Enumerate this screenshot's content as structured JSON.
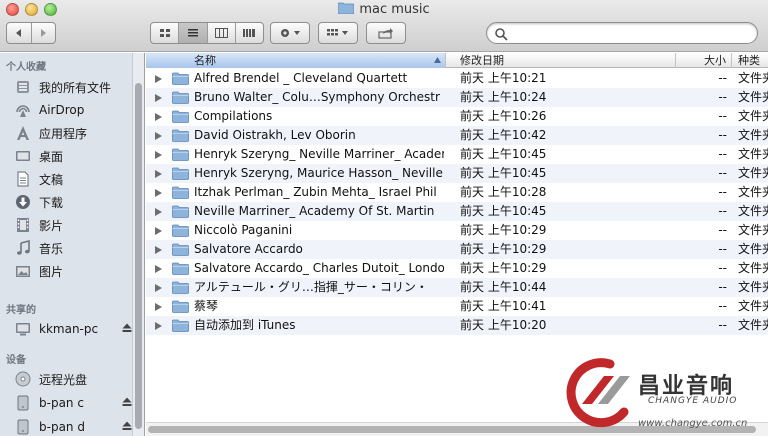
{
  "window": {
    "title": "mac music"
  },
  "search": {
    "value": "",
    "placeholder": ""
  },
  "sidebar": {
    "sections": [
      {
        "title": "个人收藏",
        "items": [
          {
            "label": "我的所有文件",
            "icon": "all-files-icon"
          },
          {
            "label": "AirDrop",
            "icon": "airdrop-icon"
          },
          {
            "label": "应用程序",
            "icon": "applications-icon"
          },
          {
            "label": "桌面",
            "icon": "desktop-icon"
          },
          {
            "label": "文稿",
            "icon": "documents-icon"
          },
          {
            "label": "下载",
            "icon": "downloads-icon"
          },
          {
            "label": "影片",
            "icon": "movies-icon"
          },
          {
            "label": "音乐",
            "icon": "music-icon"
          },
          {
            "label": "图片",
            "icon": "pictures-icon"
          }
        ]
      },
      {
        "title": "共享的",
        "items": [
          {
            "label": "kkman-pc",
            "icon": "network-computer-icon",
            "eject": true
          }
        ]
      },
      {
        "title": "设备",
        "items": [
          {
            "label": "远程光盘",
            "icon": "remote-disc-icon"
          },
          {
            "label": "b-pan c",
            "icon": "drive-icon",
            "eject": true
          },
          {
            "label": "b-pan d",
            "icon": "drive-icon",
            "eject": true
          }
        ]
      }
    ]
  },
  "columns": {
    "name": "名称",
    "date": "修改日期",
    "size": "大小",
    "kind": "种类"
  },
  "files": [
    {
      "name": "Alfred Brendel _ Cleveland Quartett",
      "date": "前天 上午10:21",
      "size": "--",
      "kind": "文件夹"
    },
    {
      "name": "Bruno Walter_ Colu…Symphony Orchestr",
      "date": "前天 上午10:24",
      "size": "--",
      "kind": "文件夹"
    },
    {
      "name": "Compilations",
      "date": "前天 上午10:26",
      "size": "--",
      "kind": "文件夹"
    },
    {
      "name": "David Oistrakh, Lev Oborin",
      "date": "前天 上午10:42",
      "size": "--",
      "kind": "文件夹"
    },
    {
      "name": "Henryk Szeryng_ Neville Marriner_ Academ",
      "date": "前天 上午10:45",
      "size": "--",
      "kind": "文件夹"
    },
    {
      "name": "Henryk Szeryng, Maurice Hasson_ Neville",
      "date": "前天 上午10:45",
      "size": "--",
      "kind": "文件夹"
    },
    {
      "name": "Itzhak Perlman_ Zubin Mehta_ Israel Phil",
      "date": "前天 上午10:28",
      "size": "--",
      "kind": "文件夹"
    },
    {
      "name": "Neville Marriner_ Academy Of St. Martin",
      "date": "前天 上午10:45",
      "size": "--",
      "kind": "文件夹"
    },
    {
      "name": "Niccolò Paganini",
      "date": "前天 上午10:29",
      "size": "--",
      "kind": "文件夹"
    },
    {
      "name": "Salvatore Accardo",
      "date": "前天 上午10:29",
      "size": "--",
      "kind": "文件夹"
    },
    {
      "name": "Salvatore Accardo_ Charles Dutoit_ Londo",
      "date": "前天 上午10:29",
      "size": "--",
      "kind": "文件夹"
    },
    {
      "name": "アルテュール・グリ…指揮_サー・コリン・",
      "date": "前天 上午10:44",
      "size": "--",
      "kind": "文件夹"
    },
    {
      "name": "蔡琴",
      "date": "前天 上午10:41",
      "size": "--",
      "kind": "文件夹"
    },
    {
      "name": "自动添加到 iTunes",
      "date": "前天 上午10:20",
      "size": "--",
      "kind": "文件夹"
    }
  ],
  "watermark": {
    "brand_cn": "昌业音响",
    "brand_en": "CHANGYE AUDIO",
    "url": "www.changye.com.cn"
  },
  "colors": {
    "folder": "#8fb4dc",
    "selection_header": "#a9c5ec",
    "sidebar_bg": "#dde3ea",
    "watermark_red": "#c0282a"
  }
}
